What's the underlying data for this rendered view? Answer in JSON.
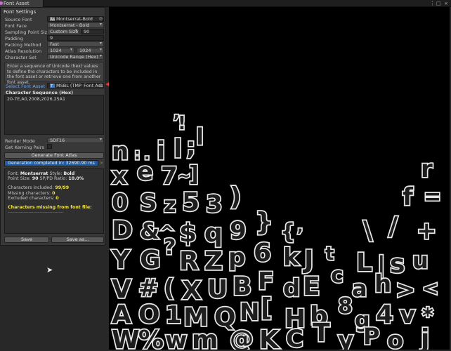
{
  "window": {
    "tab_title": "Font Asset Creator",
    "controls": [
      "⋮",
      "□",
      "×"
    ]
  },
  "panel": {
    "section_title": "Font Settings",
    "fields": {
      "source_font": {
        "label": "Source Font",
        "value": "Montserrat-Bold"
      },
      "font_face": {
        "label": "Font Face",
        "value": "Montserrat - Bold"
      },
      "sampling": {
        "label": "Sampling Point Size",
        "mode": "Custom Size",
        "value": "90"
      },
      "padding": {
        "label": "Padding",
        "value": "9"
      },
      "packing": {
        "label": "Packing Method",
        "value": "Fast"
      },
      "atlas": {
        "label": "Atlas Resolution",
        "width": "1024",
        "height": "1024"
      },
      "charset": {
        "label": "Character Set",
        "value": "Unicode Range (Hex)"
      }
    },
    "help_text": "Enter a sequence of Unicode (hex) values to define the characters to be included in the font asset or retrieve one from another font asset.",
    "select_font_asset": {
      "label": "Select Font Asset",
      "value": "MSBL (TMP_Font Asset)"
    },
    "sequence": {
      "label": "Character Sequence (Hex)",
      "value": "20-7E,A0,2008,2026,25A1"
    },
    "render_mode": {
      "label": "Render Mode",
      "value": "SDF16"
    },
    "kerning": {
      "label": "Get Kerning Pairs"
    },
    "generate_label": "Generate Font Atlas",
    "progress_label": "Generation completed in: 32690.90 ms",
    "progress_close": "×",
    "progress_fraction": 1.0,
    "info": {
      "font_label": "Font:",
      "font": "Montserrat",
      "style_label": "Style:",
      "style": "Bold",
      "size_label": "Point Size:",
      "size": "90",
      "ratio_label": "SP/PD Ratio:",
      "ratio": "10.0%",
      "included_label": "Characters included:",
      "included": "99/99",
      "missing_label": "Missing characters:",
      "missing": "0",
      "excluded_label": "Excluded characters:",
      "excluded": "0",
      "missing_heading": "Characters missing from font file:",
      "divider": "-----------------------------------"
    },
    "save_label": "Save",
    "save_as_label": "Save as..."
  },
  "atlas_glyphs": [
    "n",
    ":",
    ".",
    "i",
    "l",
    ";",
    "l",
    "!",
    ",",
    "x",
    "e",
    "7",
    "~",
    "]",
    "r",
    "0",
    "S",
    "z",
    "5",
    "3",
    ")",
    "f",
    "=",
    "D",
    "&",
    "^",
    "$",
    "q",
    "9",
    "}",
    "{",
    ",",
    "\\",
    "/",
    "+",
    "Y",
    "G",
    "?",
    "R",
    "Z",
    "p",
    "6",
    "k",
    "J",
    "t",
    "L",
    "|",
    "s",
    "u",
    "V",
    "#",
    "(",
    "X",
    "U",
    "B",
    "F",
    "d",
    "E",
    "c",
    "a",
    "h",
    ">",
    "<",
    "A",
    "O",
    "1",
    "M",
    "Q",
    "N",
    "[",
    "H",
    "b",
    "8",
    "g",
    "4",
    "v",
    "*",
    "W",
    "%",
    "w",
    "m",
    "@",
    "K",
    "C",
    "T",
    "y",
    "P",
    "o",
    "j"
  ],
  "colors": {
    "accent_blue": "#1e5ea8",
    "label_blue": "#6fa6e8",
    "highlight_yellow": "#f2e44b",
    "arrow_red": "#e8343a",
    "tab_dot": "#c96bd2"
  }
}
